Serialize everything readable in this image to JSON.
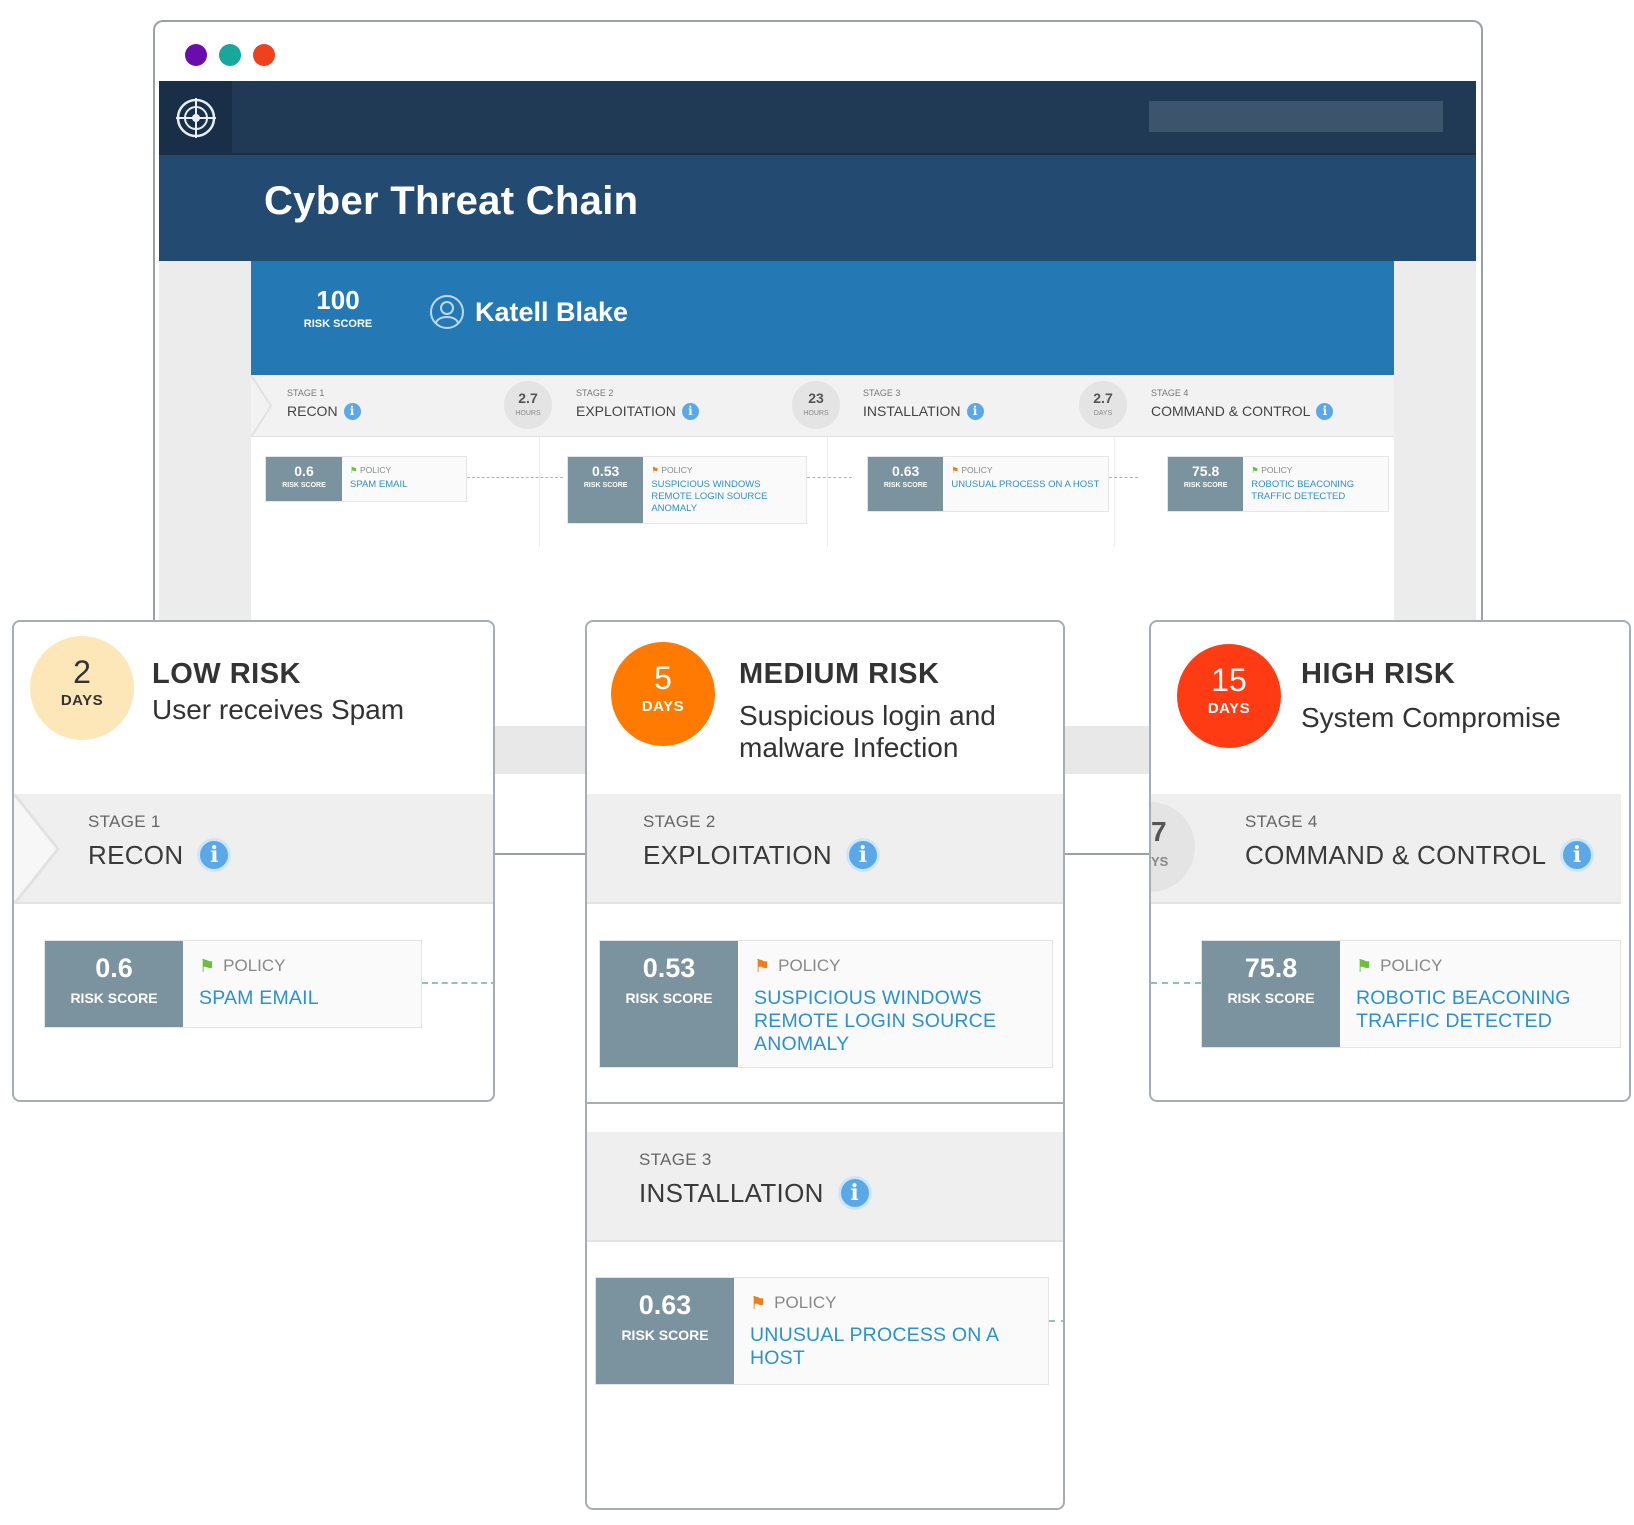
{
  "window": {
    "dots": [
      {
        "name": "purple-dot",
        "color": "#6a0dad"
      },
      {
        "name": "teal-dot",
        "color": "#17a89c"
      },
      {
        "name": "red-dot",
        "color": "#f0411e"
      }
    ]
  },
  "app": {
    "logo_icon": "target-globe-icon",
    "title": "Cyber Threat Chain"
  },
  "user": {
    "risk_score": "100",
    "risk_score_label": "RISK SCORE",
    "icon": "user-circle-icon",
    "name": "Katell Blake"
  },
  "stages": [
    {
      "label": "STAGE 1",
      "name": "RECON",
      "info_icon": "info-icon",
      "score": "0.6",
      "score_label": "RISK SCORE",
      "policy_label": "POLICY",
      "policy_flag_color": "#6bbf3a",
      "policy": "SPAM EMAIL"
    },
    {
      "label": "STAGE 2",
      "name": "EXPLOITATION",
      "info_icon": "info-icon",
      "score": "0.53",
      "score_label": "RISK SCORE",
      "policy_label": "POLICY",
      "policy_flag_color": "#f07d1a",
      "policy": "SUSPICIOUS WINDOWS REMOTE LOGIN SOURCE ANOMALY"
    },
    {
      "label": "STAGE 3",
      "name": "INSTALLATION",
      "info_icon": "info-icon",
      "score": "0.63",
      "score_label": "RISK SCORE",
      "policy_label": "POLICY",
      "policy_flag_color": "#f07d1a",
      "policy": "UNUSUAL PROCESS ON A HOST"
    },
    {
      "label": "STAGE 4",
      "name": "COMMAND & CONTROL",
      "info_icon": "info-icon",
      "score": "75.8",
      "score_label": "RISK SCORE",
      "policy_label": "POLICY",
      "policy_flag_color": "#6bbf3a",
      "policy": "ROBOTIC BEACONING TRAFFIC DETECTED"
    }
  ],
  "durations": [
    {
      "value": "2.7",
      "unit": "HOURS"
    },
    {
      "value": "23",
      "unit": "HOURS"
    },
    {
      "value": "2.7",
      "unit": "DAYS"
    }
  ],
  "panels": {
    "low": {
      "days": "2",
      "days_label": "DAYS",
      "badge_color": "#fde6b8",
      "badge_text_color": "#333333",
      "title": "LOW RISK",
      "desc": "User receives Spam"
    },
    "medium": {
      "days": "5",
      "days_label": "DAYS",
      "badge_color": "#ff7a00",
      "badge_text_color": "#ffffff",
      "title": "MEDIUM RISK",
      "desc_line1": "Suspicious login and",
      "desc_line2": "malware Infection"
    },
    "high": {
      "days": "15",
      "days_label": "DAYS",
      "badge_color": "#ff3b14",
      "badge_text_color": "#ffffff",
      "title": "HIGH RISK",
      "desc": "System Compromise",
      "partial_duration_value": "7",
      "partial_duration_unit": "YS"
    }
  },
  "colors": {
    "topbar": "#203a55",
    "titlebar": "#234a70",
    "userbar": "#2479b5",
    "score_box": "#7b929f",
    "policy_link": "#2b91d0",
    "info": "#5aa8e8"
  }
}
